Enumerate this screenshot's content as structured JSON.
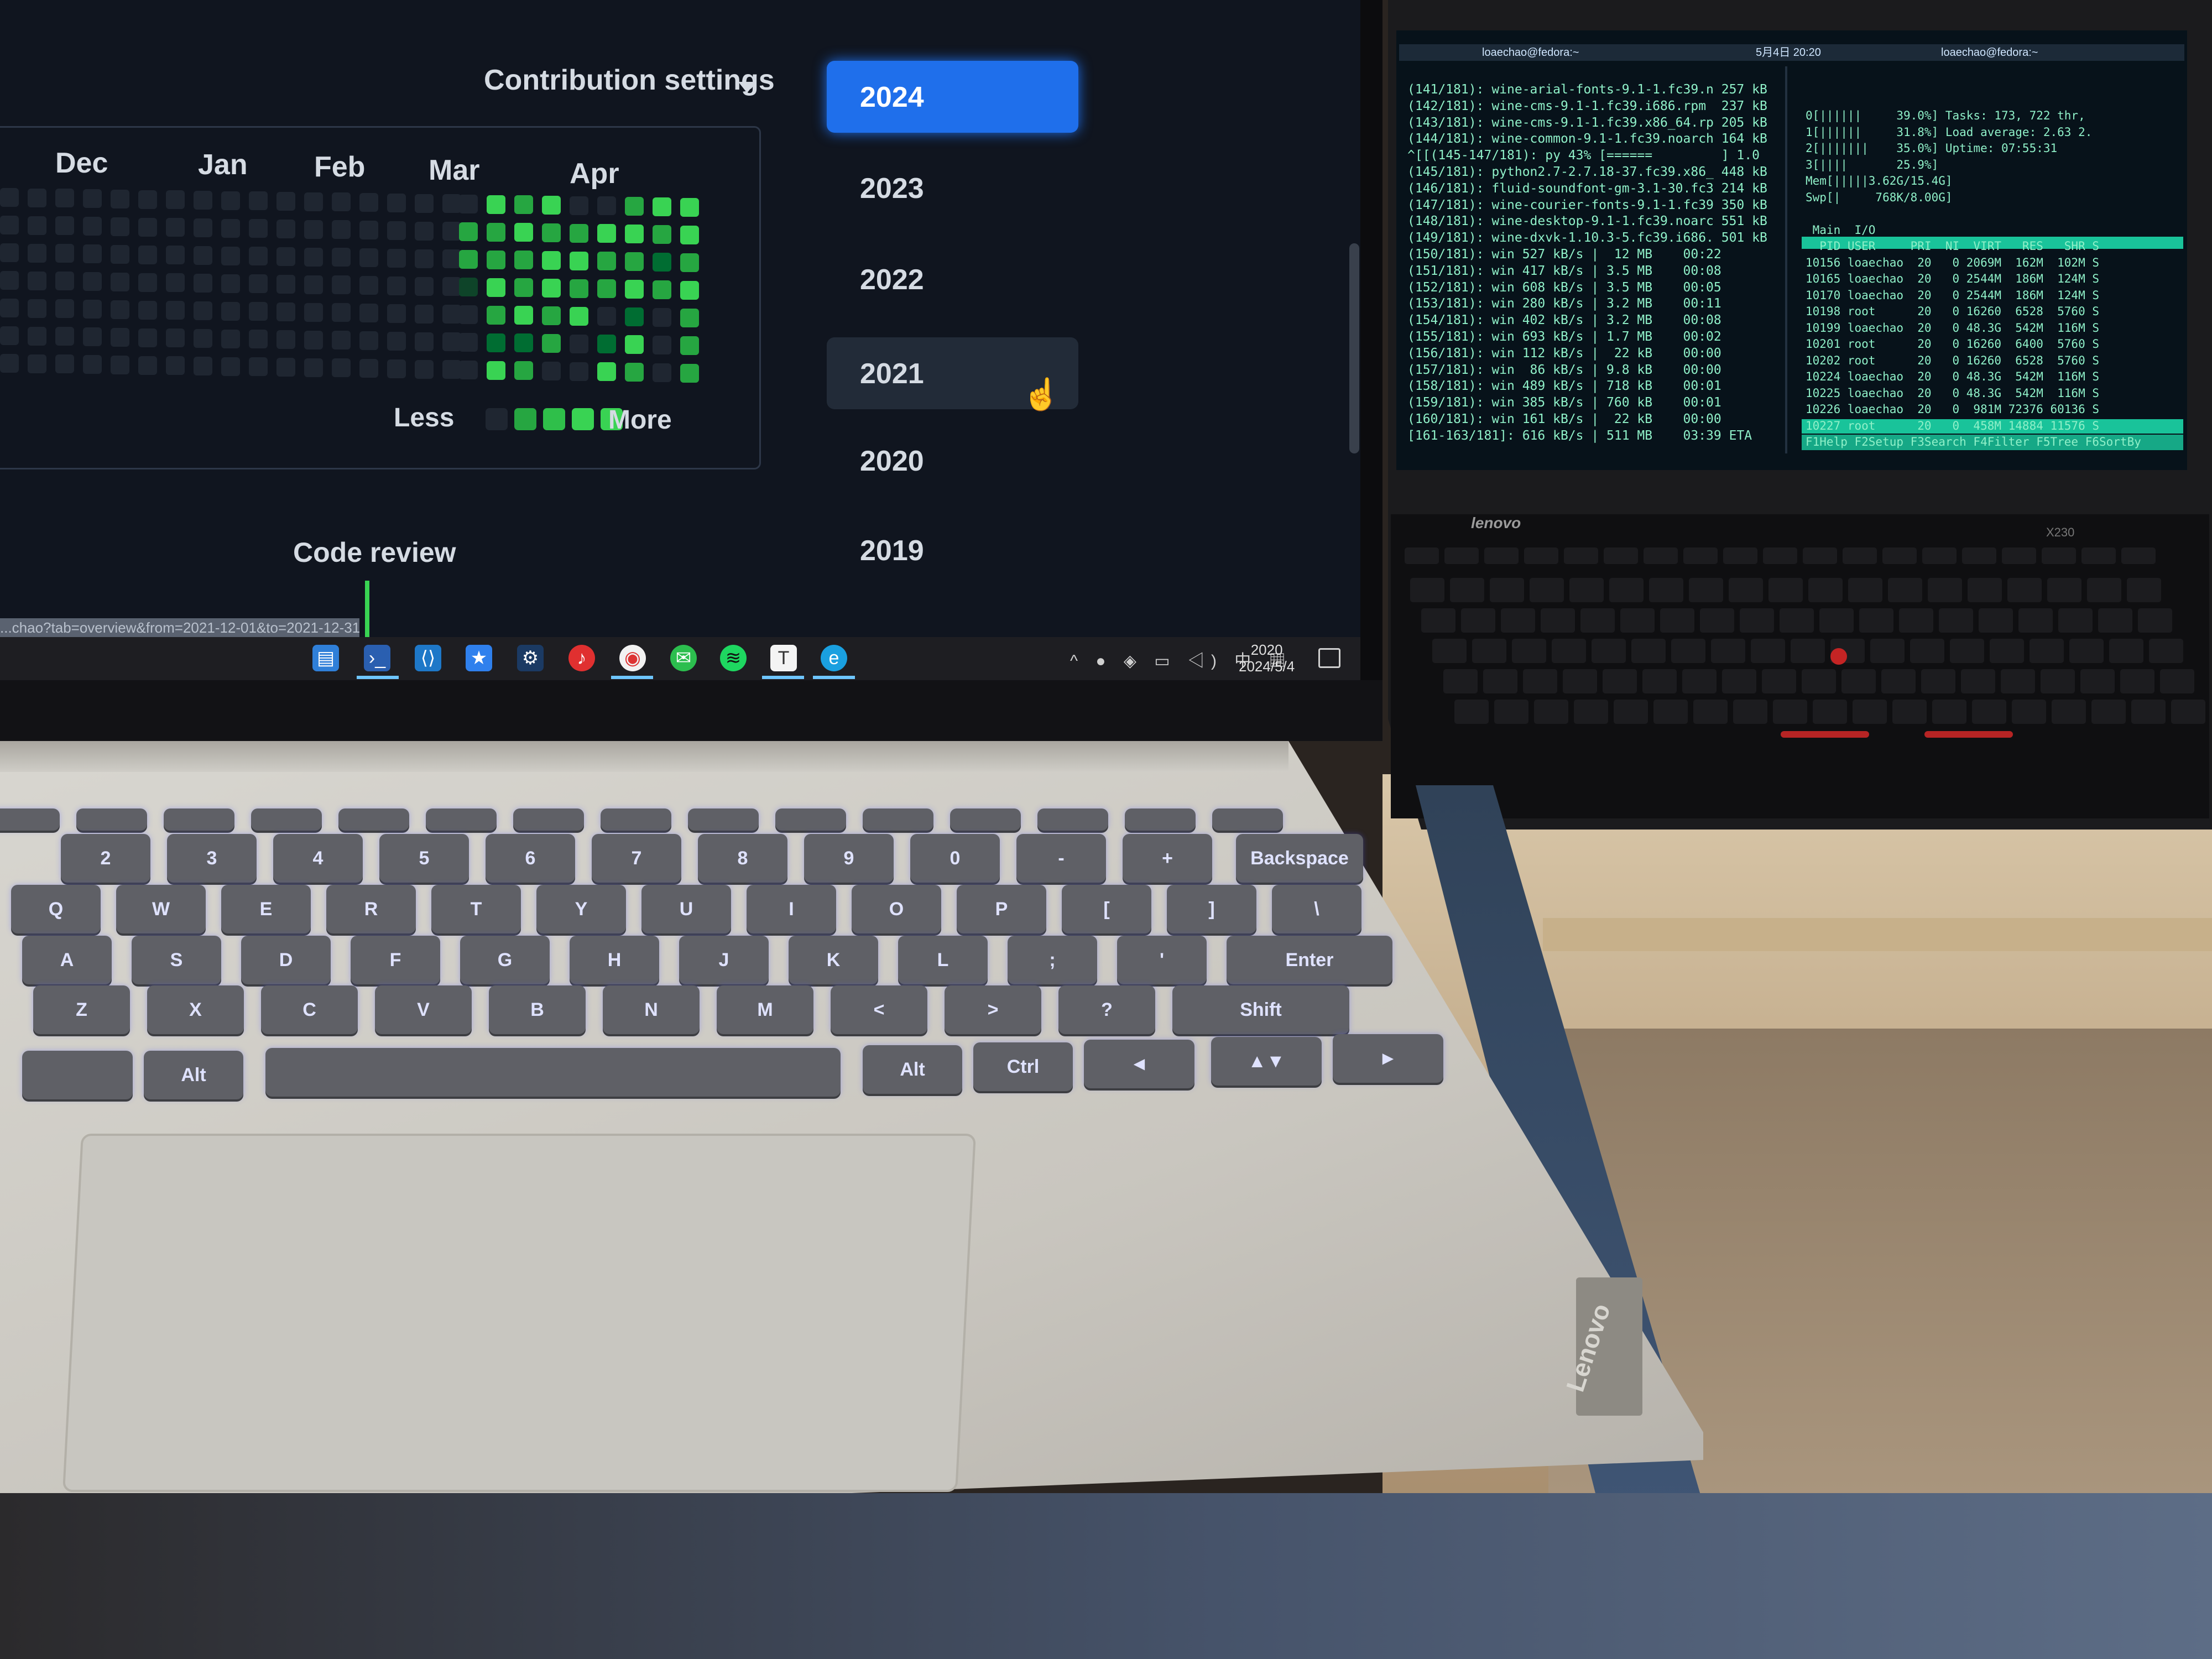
{
  "github": {
    "contribution_settings": "Contribution settings",
    "months": [
      "Dec",
      "Jan",
      "Feb",
      "Mar",
      "Apr"
    ],
    "legend_less": "Less",
    "legend_more": "More",
    "code_review": "Code review",
    "years": [
      "2024",
      "2023",
      "2022",
      "2021",
      "2020",
      "2019"
    ],
    "selected_year": "2024",
    "hovered_year": "2021",
    "url": "...chao?tab=overview&from=2021-12-01&to=2021-12-31",
    "heatmap_colors": [
      "#1f2631",
      "#0e4429",
      "#006d32",
      "#26a641",
      "#39d353"
    ]
  },
  "taskbar": {
    "icons": [
      "file-explorer-icon",
      "powershell-icon",
      "vscode-icon",
      "pinned-app-icon",
      "steam-icon",
      "netease-music-icon",
      "chrome-icon",
      "wechat-icon",
      "spotify-icon",
      "typora-icon",
      "edge-icon"
    ],
    "time": "2020",
    "date": "2024/5/4",
    "tray_icons": [
      "chevron-up-icon",
      "wechat-tray-icon",
      "network-icon",
      "battery-icon",
      "volume-icon",
      "ime-icon",
      "keyboard-icon"
    ]
  },
  "keyboard": {
    "row_numbers": [
      "@\n2",
      "#\n3",
      "$\n4",
      "%\n5",
      "6",
      "7",
      "8",
      "9",
      "0",
      "-",
      "+"
    ],
    "row_q": [
      "Q",
      "W",
      "E",
      "R",
      "T",
      "Y",
      "U",
      "I",
      "O",
      "P",
      "[",
      "]",
      "\\"
    ],
    "row_a": [
      "A",
      "S",
      "D",
      "F",
      "G",
      "H",
      "J",
      "K",
      "L",
      ";",
      "'",
      "Enter"
    ],
    "row_z": [
      "Z",
      "X",
      "C",
      "V",
      "B",
      "N",
      "M",
      "<",
      ">",
      "?",
      "Shift"
    ],
    "row_bottom": [
      "",
      "Alt",
      "",
      "Alt",
      "Ctrl"
    ],
    "backspace": "Backspace",
    "brand": "Lenovo"
  },
  "thinkpad": {
    "brand": "lenovo",
    "model": "X230",
    "clock": "5月4日 20:20",
    "left_title": "loaechao@fedora:~",
    "right_title": "loaechao@fedora:~",
    "term_left": [
      "(141/181): wine-arial-fonts-9.1-1.fc39.n 257 kB",
      "(142/181): wine-cms-9.1-1.fc39.i686.rpm  237 kB",
      "(143/181): wine-cms-9.1-1.fc39.x86_64.rp 205 kB",
      "(144/181): wine-common-9.1-1.fc39.noarch 164 kB",
      "^[[(145-147/181): py 43% [======         ] 1.0",
      "(145/181): python2.7-2.7.18-37.fc39.x86_ 448 kB",
      "(146/181): fluid-soundfont-gm-3.1-30.fc3 214 kB",
      "(147/181): wine-courier-fonts-9.1-1.fc39 350 kB",
      "(148/181): wine-desktop-9.1-1.fc39.noarc 551 kB",
      "(149/181): wine-dxvk-1.10.3-5.fc39.i686. 501 kB",
      "(150/181): win 527 kB/s |  12 MB    00:22",
      "(151/181): win 417 kB/s | 3.5 MB    00:08",
      "(152/181): win 608 kB/s | 3.5 MB    00:05",
      "(153/181): win 280 kB/s | 3.2 MB    00:11",
      "(154/181): win 402 kB/s | 3.2 MB    00:08",
      "(155/181): win 693 kB/s | 1.7 MB    00:02",
      "(156/181): win 112 kB/s |  22 kB    00:00",
      "(157/181): win  86 kB/s | 9.8 kB    00:00",
      "(158/181): win 489 kB/s | 718 kB    00:01",
      "(159/181): win 385 kB/s | 760 kB    00:01",
      "(160/181): win 161 kB/s |  22 kB    00:00",
      "[161-163/181]: 616 kB/s | 511 MB    03:39 ETA"
    ],
    "term_right": [
      "0[||||||     39.0%] Tasks: 173, 722 thr,",
      "1[||||||     31.8%] Load average: 2.63 2.",
      "2[|||||||    35.0%] Uptime: 07:55:31",
      "3[||||       25.9%]",
      "Mem[|||||3.62G/15.4G]",
      "Swp[|     768K/8.00G]",
      "",
      " Main  I/O",
      "  PID USER     PRI  NI  VIRT   RES   SHR S",
      "10156 loaechao  20   0 2069M  162M  102M S",
      "10165 loaechao  20   0 2544M  186M  124M S",
      "10170 loaechao  20   0 2544M  186M  124M S",
      "10198 root      20   0 16260  6528  5760 S",
      "10199 loaechao  20   0 48.3G  542M  116M S",
      "10201 root      20   0 16260  6400  5760 S",
      "10202 root      20   0 16260  6528  5760 S",
      "10224 loaechao  20   0 48.3G  542M  116M S",
      "10225 loaechao  20   0 48.3G  542M  116M S",
      "10226 loaechao  20   0  981M 72376 60136 S",
      "10227 root      20   0  458M 14884 11576 S",
      "F1Help F2Setup F3Search F4Filter F5Tree F6SortBy"
    ]
  }
}
